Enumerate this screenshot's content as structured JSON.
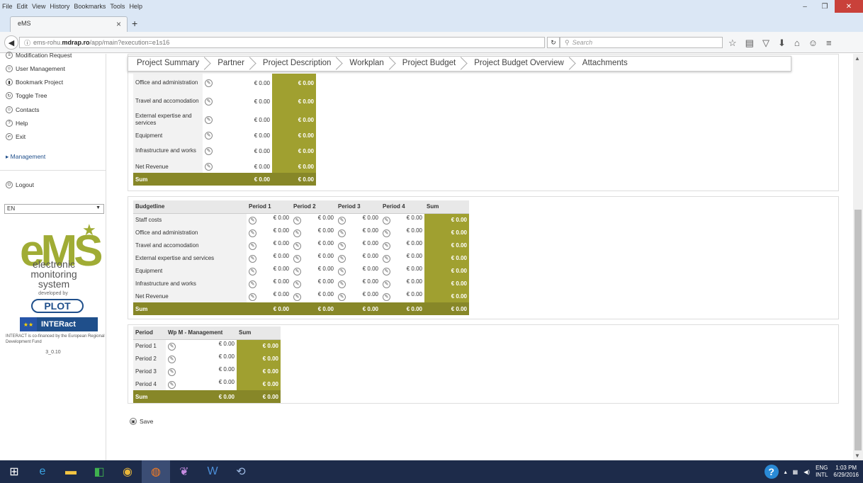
{
  "browser": {
    "menu": [
      "File",
      "Edit",
      "View",
      "History",
      "Bookmarks",
      "Tools",
      "Help"
    ],
    "tab_title": "eMS",
    "url_prefix": "ems-rohu.",
    "url_domain": "mdrap.ro",
    "url_path": "/app/main?execution=e1s16",
    "search_placeholder": "Search"
  },
  "sidebar": {
    "items": [
      "Modification Request",
      "User Management",
      "Bookmark Project",
      "Toggle Tree",
      "Contacts",
      "Help",
      "Exit"
    ],
    "management": "Management",
    "logout": "Logout",
    "language": "EN",
    "logo": "eMS",
    "logo_sub1": "electronic",
    "logo_sub2": "monitoring",
    "logo_sub3": "system",
    "developed_by": "developed by",
    "plot": "PLOT",
    "interact": "INTERact",
    "cofinanced": "INTERACT is co-financed by the European Regional Development Fund",
    "version": "3_0.10"
  },
  "tabs": [
    "Project Summary",
    "Partner",
    "Project Description",
    "Workplan",
    "Project Budget",
    "Project Budget Overview",
    "Attachments"
  ],
  "table1": {
    "rows": [
      {
        "label": "Office and administration",
        "value": "€ 0.00",
        "sum": "€ 0.00"
      },
      {
        "label": "Travel and accomodation",
        "value": "€ 0.00",
        "sum": "€ 0.00"
      },
      {
        "label": "External expertise and services",
        "value": "€ 0.00",
        "sum": "€ 0.00"
      },
      {
        "label": "Equipment",
        "value": "€ 0.00",
        "sum": "€ 0.00"
      },
      {
        "label": "Infrastructure and works",
        "value": "€ 0.00",
        "sum": "€ 0.00"
      },
      {
        "label": "Net Revenue",
        "value": "€ 0.00",
        "sum": "€ 0.00"
      }
    ],
    "sum_label": "Sum",
    "sum_value": "€ 0.00",
    "sum_total": "€ 0.00"
  },
  "table2": {
    "headers": [
      "Budgetline",
      "Period 1",
      "Period 2",
      "Period 3",
      "Period 4",
      "Sum"
    ],
    "rows": [
      {
        "label": "Staff costs",
        "p1": "€ 0.00",
        "p2": "€ 0.00",
        "p3": "€ 0.00",
        "p4": "€ 0.00",
        "sum": "€ 0.00"
      },
      {
        "label": "Office and administration",
        "p1": "€ 0.00",
        "p2": "€ 0.00",
        "p3": "€ 0.00",
        "p4": "€ 0.00",
        "sum": "€ 0.00"
      },
      {
        "label": "Travel and accomodation",
        "p1": "€ 0.00",
        "p2": "€ 0.00",
        "p3": "€ 0.00",
        "p4": "€ 0.00",
        "sum": "€ 0.00"
      },
      {
        "label": "External expertise and services",
        "p1": "€ 0.00",
        "p2": "€ 0.00",
        "p3": "€ 0.00",
        "p4": "€ 0.00",
        "sum": "€ 0.00"
      },
      {
        "label": "Equipment",
        "p1": "€ 0.00",
        "p2": "€ 0.00",
        "p3": "€ 0.00",
        "p4": "€ 0.00",
        "sum": "€ 0.00"
      },
      {
        "label": "Infrastructure and works",
        "p1": "€ 0.00",
        "p2": "€ 0.00",
        "p3": "€ 0.00",
        "p4": "€ 0.00",
        "sum": "€ 0.00"
      },
      {
        "label": "Net Revenue",
        "p1": "€ 0.00",
        "p2": "€ 0.00",
        "p3": "€ 0.00",
        "p4": "€ 0.00",
        "sum": "€ 0.00"
      }
    ],
    "sum_row": {
      "label": "Sum",
      "p1": "€ 0.00",
      "p2": "€ 0.00",
      "p3": "€ 0.00",
      "p4": "€ 0.00",
      "sum": "€ 0.00"
    }
  },
  "table3": {
    "headers": [
      "Period",
      "Wp M - Management",
      "Sum"
    ],
    "rows": [
      {
        "label": "Period 1",
        "value": "€ 0.00",
        "sum": "€ 0.00"
      },
      {
        "label": "Period 2",
        "value": "€ 0.00",
        "sum": "€ 0.00"
      },
      {
        "label": "Period 3",
        "value": "€ 0.00",
        "sum": "€ 0.00"
      },
      {
        "label": "Period 4",
        "value": "€ 0.00",
        "sum": "€ 0.00"
      }
    ],
    "sum_row": {
      "label": "Sum",
      "value": "€ 0.00",
      "sum": "€ 0.00"
    }
  },
  "save_label": "Save",
  "taskbar": {
    "lang1": "ENG",
    "lang2": "INTL",
    "time": "1:03 PM",
    "date": "6/29/2016"
  },
  "colors": {
    "olive": "#a0a030",
    "dark_olive": "#878728",
    "brand": "#a0ac35",
    "navy": "#1f4f8b"
  }
}
